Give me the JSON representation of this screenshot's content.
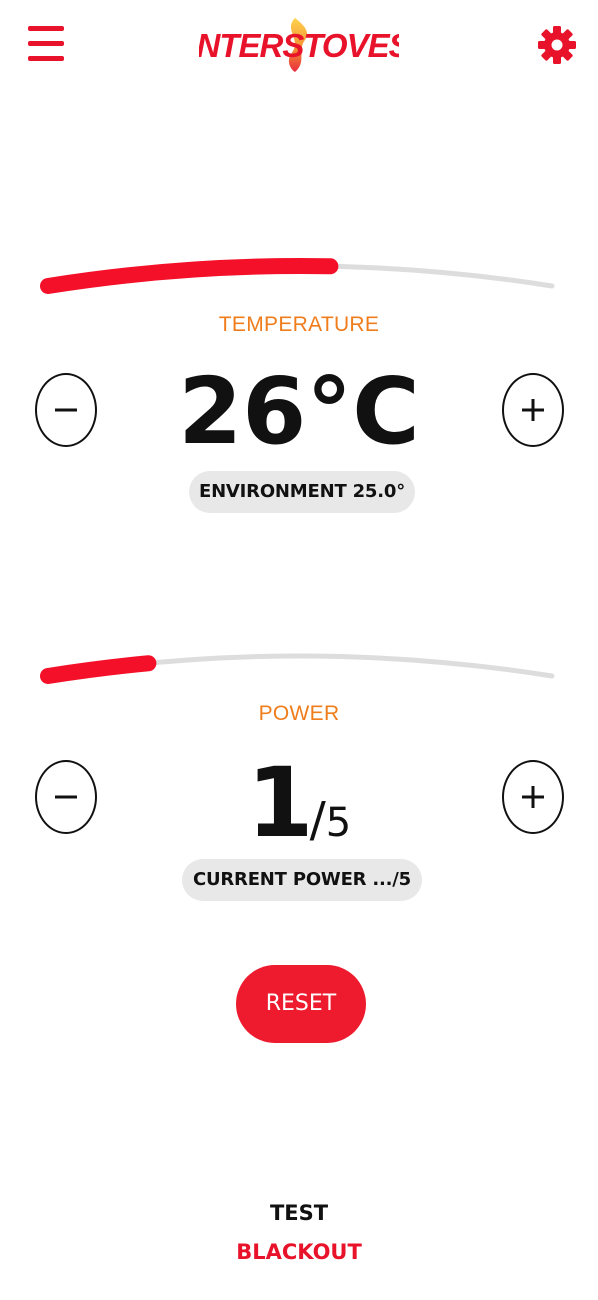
{
  "header": {
    "logo_text": "INTERSTOVES",
    "menu_icon": "hamburger-menu-icon",
    "settings_icon": "gear-icon"
  },
  "colors": {
    "brand_red": "#e8132a",
    "label_orange": "#f07d1c",
    "track_gray": "#dddddd",
    "pill_gray": "#e8e8e8"
  },
  "temperature": {
    "label": "TEMPERATURE",
    "value": "26°C",
    "environment": "ENVIRONMENT 25.0°",
    "gauge_fraction": 0.56
  },
  "power": {
    "label": "POWER",
    "current": "1",
    "separator": "/",
    "max": "5",
    "current_power": "CURRENT POWER .../5",
    "gauge_fraction": 0.2
  },
  "actions": {
    "reset_label": "RESET",
    "test_label": "TEST",
    "blackout_label": "BLACKOUT"
  }
}
